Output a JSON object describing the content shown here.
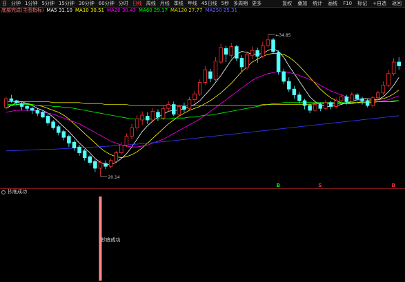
{
  "toolbar": {
    "buttons": [
      "日",
      "分钟",
      "1分钟",
      "5分钟",
      "15分钟",
      "30分钟",
      "60分钟",
      "分时",
      "日线",
      "周线",
      "月线",
      "季线",
      "年线",
      "45日线",
      "5秒",
      "多周期",
      "更多"
    ],
    "active_index": 8,
    "right_buttons": [
      "复权",
      "叠加",
      "统计",
      "画线",
      "F10",
      "标记",
      "+自选",
      "返回"
    ]
  },
  "infobar": {
    "title": "底部完成(主图指标)",
    "ma5": "MA5 31.10",
    "ma10": "MA10 30.51",
    "ma20": "MA20 30.43",
    "ma60": "MA60 29.17",
    "ma120": "MA120 27.77",
    "ma250": "MA250 25.31"
  },
  "colors": {
    "up": "#ff3232",
    "down": "#54ffff",
    "ma5": "#ffffff",
    "ma10": "#ffff00",
    "ma20": "#ff00ff",
    "ma60": "#00ff00",
    "ma120": "#dddd00",
    "ma250": "#3a3aff",
    "signal_bar": "#ff8888"
  },
  "chart_data": {
    "type": "candlestick",
    "high_label": "34.85",
    "low_label": "20.14",
    "candles": [
      [
        27.3,
        28.2,
        28.4,
        27.1
      ],
      [
        28.2,
        28.0,
        28.6,
        27.8
      ],
      [
        28.0,
        27.8,
        28.1,
        27.5
      ],
      [
        27.7,
        27.4,
        27.9,
        27.0
      ],
      [
        27.4,
        27.2,
        27.6,
        26.9
      ],
      [
        27.2,
        27.0,
        27.4,
        26.6
      ],
      [
        27.0,
        26.7,
        27.2,
        26.4
      ],
      [
        26.8,
        26.3,
        27.0,
        26.2
      ],
      [
        26.4,
        25.7,
        26.6,
        25.4
      ],
      [
        25.8,
        25.2,
        26.0,
        25.0
      ],
      [
        25.3,
        24.7,
        25.5,
        24.4
      ],
      [
        24.8,
        24.2,
        25.0,
        23.9
      ],
      [
        24.3,
        23.6,
        24.5,
        23.2
      ],
      [
        23.7,
        23.1,
        23.9,
        22.8
      ],
      [
        23.2,
        22.6,
        23.4,
        22.3
      ],
      [
        22.8,
        22.1,
        23.0,
        21.8
      ],
      [
        22.2,
        21.6,
        22.4,
        21.3
      ],
      [
        21.7,
        21.0,
        21.9,
        20.6
      ],
      [
        21.0,
        21.6,
        21.8,
        20.14
      ],
      [
        21.5,
        21.2,
        21.8,
        20.9
      ],
      [
        21.2,
        21.8,
        22.0,
        21.0
      ],
      [
        21.7,
        22.6,
        22.8,
        21.6
      ],
      [
        22.6,
        23.4,
        23.7,
        22.4
      ],
      [
        23.4,
        24.3,
        24.6,
        23.2
      ],
      [
        24.3,
        25.2,
        25.6,
        24.0
      ],
      [
        25.2,
        26.1,
        26.5,
        24.9
      ],
      [
        26.0,
        26.5,
        26.9,
        25.5
      ],
      [
        26.4,
        26.0,
        26.8,
        25.6
      ],
      [
        26.0,
        26.9,
        27.2,
        25.8
      ],
      [
        26.8,
        26.3,
        27.1,
        25.9
      ],
      [
        26.2,
        27.2,
        27.5,
        26.0
      ],
      [
        27.2,
        27.6,
        28.0,
        26.9
      ],
      [
        27.6,
        26.6,
        27.9,
        26.4
      ],
      [
        26.6,
        27.4,
        27.6,
        26.3
      ],
      [
        27.4,
        27.1,
        27.8,
        26.8
      ],
      [
        27.2,
        28.1,
        28.4,
        27.0
      ],
      [
        28.1,
        28.7,
        29.0,
        27.8
      ],
      [
        28.7,
        29.9,
        30.2,
        28.5
      ],
      [
        29.9,
        31.2,
        31.6,
        29.6
      ],
      [
        31.0,
        30.3,
        31.3,
        29.9
      ],
      [
        30.2,
        32.1,
        32.5,
        30.0
      ],
      [
        32.0,
        33.5,
        33.9,
        31.8
      ],
      [
        33.4,
        32.8,
        33.7,
        32.0
      ],
      [
        32.7,
        33.6,
        34.0,
        32.4
      ],
      [
        33.6,
        32.4,
        33.8,
        32.1
      ],
      [
        32.4,
        31.5,
        32.7,
        31.0
      ],
      [
        31.4,
        32.8,
        33.1,
        31.2
      ],
      [
        32.7,
        33.2,
        33.6,
        32.3
      ],
      [
        33.2,
        32.6,
        33.5,
        31.9
      ],
      [
        32.6,
        33.7,
        34.1,
        32.4
      ],
      [
        33.7,
        34.3,
        34.85,
        33.5
      ],
      [
        34.3,
        33.1,
        34.5,
        32.8
      ],
      [
        33.0,
        31.0,
        33.2,
        30.7
      ],
      [
        31.0,
        30.0,
        31.3,
        29.7
      ],
      [
        30.0,
        29.2,
        30.4,
        28.9
      ],
      [
        29.2,
        28.6,
        29.5,
        28.2
      ],
      [
        28.6,
        28.0,
        28.9,
        27.7
      ],
      [
        28.0,
        27.5,
        28.2,
        27.1
      ],
      [
        27.5,
        27.0,
        27.7,
        26.7
      ],
      [
        27.0,
        27.6,
        27.9,
        26.8
      ],
      [
        27.6,
        27.2,
        27.8,
        26.9
      ],
      [
        27.2,
        27.8,
        28.1,
        27.0
      ],
      [
        27.8,
        27.4,
        28.0,
        27.1
      ],
      [
        27.4,
        28.0,
        28.3,
        27.2
      ],
      [
        28.0,
        28.4,
        28.7,
        27.8
      ],
      [
        28.4,
        27.9,
        28.6,
        27.6
      ],
      [
        27.9,
        28.6,
        28.9,
        27.7
      ],
      [
        28.6,
        28.2,
        28.8,
        27.9
      ],
      [
        28.2,
        28.0,
        28.4,
        27.6
      ],
      [
        28.0,
        27.5,
        28.2,
        27.3
      ],
      [
        27.5,
        28.3,
        28.5,
        27.3
      ],
      [
        28.3,
        28.8,
        29.0,
        28.0
      ],
      [
        28.8,
        29.6,
        30.0,
        28.6
      ],
      [
        29.6,
        30.8,
        31.2,
        29.4
      ],
      [
        30.8,
        32.0,
        32.4,
        30.6
      ],
      [
        32.0,
        31.6,
        32.5,
        31.2
      ]
    ],
    "ma_series": [
      {
        "name": "MA5",
        "color_key": "ma5",
        "values": [
          27.2,
          27.5,
          27.8,
          27.9,
          27.7,
          27.5,
          27.2,
          27.0,
          26.7,
          26.3,
          25.8,
          25.3,
          24.8,
          24.2,
          23.6,
          23.1,
          22.6,
          22.0,
          21.6,
          21.4,
          21.4,
          21.6,
          22.0,
          22.5,
          23.2,
          24.0,
          24.8,
          25.4,
          25.9,
          26.3,
          26.6,
          26.9,
          27.0,
          27.0,
          27.2,
          27.4,
          27.6,
          28.0,
          28.6,
          29.2,
          29.9,
          30.6,
          31.4,
          32.2,
          32.8,
          33.1,
          33.0,
          32.8,
          32.8,
          32.9,
          33.2,
          33.4,
          33.1,
          32.5,
          31.6,
          30.8,
          30.0,
          29.2,
          28.4,
          27.9,
          27.6,
          27.4,
          27.4,
          27.5,
          27.6,
          27.8,
          27.9,
          28.1,
          28.2,
          28.2,
          28.1,
          28.1,
          28.4,
          28.9,
          29.6,
          30.4
        ]
      },
      {
        "name": "MA10",
        "color_key": "ma10",
        "values": [
          27.4,
          27.5,
          27.6,
          27.7,
          27.7,
          27.6,
          27.5,
          27.4,
          27.2,
          27.0,
          26.8,
          26.5,
          26.1,
          25.6,
          25.1,
          24.6,
          24.1,
          23.6,
          23.1,
          22.7,
          22.4,
          22.2,
          22.1,
          22.2,
          22.4,
          22.7,
          23.1,
          23.6,
          24.1,
          24.6,
          25.1,
          25.6,
          26.0,
          26.4,
          26.7,
          27.0,
          27.2,
          27.4,
          27.7,
          28.0,
          28.4,
          28.8,
          29.3,
          29.8,
          30.4,
          31.0,
          31.5,
          32.0,
          32.3,
          32.6,
          32.8,
          32.9,
          32.9,
          32.8,
          32.5,
          32.1,
          31.6,
          31.0,
          30.4,
          29.8,
          29.2,
          28.7,
          28.3,
          28.0,
          27.8,
          27.7,
          27.7,
          27.8,
          27.9,
          28.0,
          28.0,
          28.1,
          28.2,
          28.4,
          28.7,
          29.1
        ]
      },
      {
        "name": "MA20",
        "color_key": "ma20",
        "values": [
          26.8,
          26.9,
          27.0,
          27.0,
          27.0,
          27.0,
          26.9,
          26.8,
          26.7,
          26.6,
          26.4,
          26.2,
          26.0,
          25.8,
          25.6,
          25.3,
          25.0,
          24.7,
          24.4,
          24.1,
          23.8,
          23.6,
          23.4,
          23.3,
          23.2,
          23.2,
          23.3,
          23.4,
          23.6,
          23.8,
          24.0,
          24.3,
          24.6,
          24.9,
          25.2,
          25.5,
          25.8,
          26.1,
          26.5,
          26.9,
          27.3,
          27.7,
          28.1,
          28.5,
          28.9,
          29.3,
          29.7,
          30.1,
          30.4,
          30.6,
          30.8,
          30.9,
          31.0,
          31.0,
          30.9,
          30.8,
          30.6,
          30.4,
          30.2,
          29.9,
          29.6,
          29.3,
          29.0,
          28.8,
          28.6,
          28.4,
          28.2,
          28.1,
          28.0,
          27.9,
          27.9,
          27.9,
          28.0,
          28.1,
          28.3,
          28.5
        ]
      },
      {
        "name": "MA60",
        "color_key": "ma60",
        "values": [
          27.6,
          27.6,
          27.6,
          27.6,
          27.6,
          27.6,
          27.5,
          27.5,
          27.5,
          27.4,
          27.4,
          27.3,
          27.3,
          27.2,
          27.1,
          27.0,
          26.9,
          26.8,
          26.7,
          26.6,
          26.5,
          26.4,
          26.3,
          26.2,
          26.1,
          26.1,
          26.1,
          26.1,
          26.1,
          26.1,
          26.1,
          26.1,
          26.2,
          26.2,
          26.2,
          26.3,
          26.3,
          26.4,
          26.5,
          26.5,
          26.6,
          26.7,
          26.8,
          26.9,
          27.0,
          27.1,
          27.2,
          27.3,
          27.4,
          27.5,
          27.6,
          27.7,
          27.7,
          27.8,
          27.8,
          27.8,
          27.8,
          27.8,
          27.8,
          27.8,
          27.8,
          27.8,
          27.8,
          27.8,
          27.8,
          27.8,
          27.8,
          27.8,
          27.8,
          27.8,
          27.8,
          27.9,
          27.9,
          27.9,
          28.0,
          28.0
        ]
      },
      {
        "name": "MA120",
        "color_key": "ma120",
        "values": [
          27.9,
          27.9,
          27.9,
          27.9,
          27.9,
          27.9,
          27.9,
          27.9,
          27.9,
          27.8,
          27.8,
          27.8,
          27.8,
          27.8,
          27.8,
          27.7,
          27.7,
          27.7,
          27.7,
          27.6,
          27.6,
          27.6,
          27.6,
          27.6,
          27.5,
          27.5,
          27.5,
          27.5,
          27.5,
          27.5,
          27.5,
          27.5,
          27.5,
          27.5,
          27.5,
          27.5,
          27.5,
          27.5,
          27.5,
          27.5,
          27.5,
          27.5,
          27.5,
          27.5,
          27.5,
          27.5,
          27.5,
          27.5,
          27.5,
          27.6,
          27.6,
          27.6,
          27.6,
          27.6,
          27.6,
          27.6,
          27.6,
          27.6,
          27.6,
          27.7,
          27.7,
          27.7,
          27.7,
          27.7,
          27.7,
          27.7,
          27.8,
          27.8,
          27.8,
          27.8,
          27.8,
          27.9,
          27.9,
          27.9,
          27.9,
          28.0
        ]
      },
      {
        "name": "MA250",
        "color_key": "ma250",
        "values": [
          22.8,
          22.82,
          22.84,
          22.86,
          22.88,
          22.9,
          22.92,
          22.94,
          22.96,
          22.98,
          23.0,
          23.03,
          23.06,
          23.09,
          23.12,
          23.15,
          23.18,
          23.21,
          23.24,
          23.27,
          23.3,
          23.34,
          23.38,
          23.42,
          23.46,
          23.5,
          23.55,
          23.6,
          23.65,
          23.7,
          23.75,
          23.8,
          23.86,
          23.92,
          23.98,
          24.04,
          24.1,
          24.16,
          24.22,
          24.28,
          24.34,
          24.4,
          24.46,
          24.52,
          24.58,
          24.64,
          24.7,
          24.76,
          24.82,
          24.88,
          24.94,
          25.0,
          25.06,
          25.12,
          25.18,
          25.24,
          25.3,
          25.36,
          25.42,
          25.48,
          25.54,
          25.6,
          25.66,
          25.72,
          25.78,
          25.84,
          25.9,
          25.96,
          26.02,
          26.08,
          26.14,
          26.2,
          26.26,
          26.32,
          26.38,
          26.44
        ]
      }
    ],
    "y_range": [
      19.5,
      36.5
    ],
    "markers": [
      {
        "index": 52,
        "label": "B",
        "color": "#00ff00"
      },
      {
        "index": 60,
        "label": "S",
        "color": "#ff3232"
      },
      {
        "index": 74,
        "label": "B",
        "color": "#ff3232"
      }
    ],
    "lower_panel": {
      "title": "抄底成功",
      "signal_index": 18,
      "signal_label": "抄底成功"
    }
  }
}
